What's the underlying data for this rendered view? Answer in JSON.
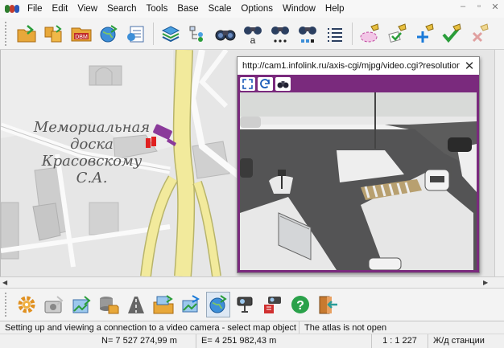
{
  "menubar": {
    "items": [
      "File",
      "Edit",
      "View",
      "Search",
      "Tools",
      "Base",
      "Scale",
      "Options",
      "Window",
      "Help"
    ],
    "window_controls": [
      "–",
      "▫",
      "✕"
    ]
  },
  "toolbar_top": {
    "buttons": [
      {
        "icon": "open-folder-icon"
      },
      {
        "icon": "open-multiple-icon"
      },
      {
        "icon": "dbm-icon",
        "label": "DBM"
      },
      {
        "icon": "globe-icon"
      },
      {
        "icon": "map-list-icon"
      },
      {
        "icon": "layers-icon"
      },
      {
        "icon": "tree-icon"
      },
      {
        "icon": "binoculars-icon"
      },
      {
        "icon": "binoculars-text-icon",
        "label": "a"
      },
      {
        "icon": "binoculars-dots-icon"
      },
      {
        "icon": "binoculars-dots-blue-icon"
      },
      {
        "icon": "list-icon"
      },
      {
        "icon": "select-area-icon"
      },
      {
        "icon": "check-object-icon"
      },
      {
        "icon": "add-object-icon"
      },
      {
        "icon": "confirm-object-icon"
      },
      {
        "icon": "delete-object-icon"
      }
    ]
  },
  "map": {
    "memorial_lines": [
      "Мемориальная",
      "доска",
      "Красовскому",
      "С.А."
    ]
  },
  "camera_window": {
    "url": "http://cam1.infolink.ru/axis-cgi/mjpg/video.cgi?resolution...",
    "close_label": "✕",
    "tools": [
      "fit-screen-icon",
      "refresh-icon",
      "binoculars-icon"
    ]
  },
  "toolbar_bottom": {
    "buttons": [
      {
        "icon": "settings-icon"
      },
      {
        "icon": "camera-photo-icon"
      },
      {
        "icon": "image-export-icon"
      },
      {
        "icon": "database-icon"
      },
      {
        "icon": "road-icon"
      },
      {
        "icon": "image-folder-icon"
      },
      {
        "icon": "photo-sync-icon"
      },
      {
        "icon": "globe-sync-icon"
      },
      {
        "icon": "video-camera-icon"
      },
      {
        "icon": "video-camera-settings-icon"
      },
      {
        "icon": "help-icon"
      },
      {
        "icon": "exit-icon"
      }
    ]
  },
  "status": {
    "message": "Setting up and viewing a connection to a video camera - select map object",
    "atlas": "The atlas is not open",
    "north": "N= 7 527 274,99 m",
    "east": "E= 4 251 982,43 m",
    "scale": "1 : 1 227",
    "layer": "Ж/д станции"
  },
  "colors": {
    "road_yellow": "#f2ea9c",
    "road_border": "#b8b46a",
    "camera_frame": "#7a2a7d",
    "building": "#cdcdcd"
  }
}
